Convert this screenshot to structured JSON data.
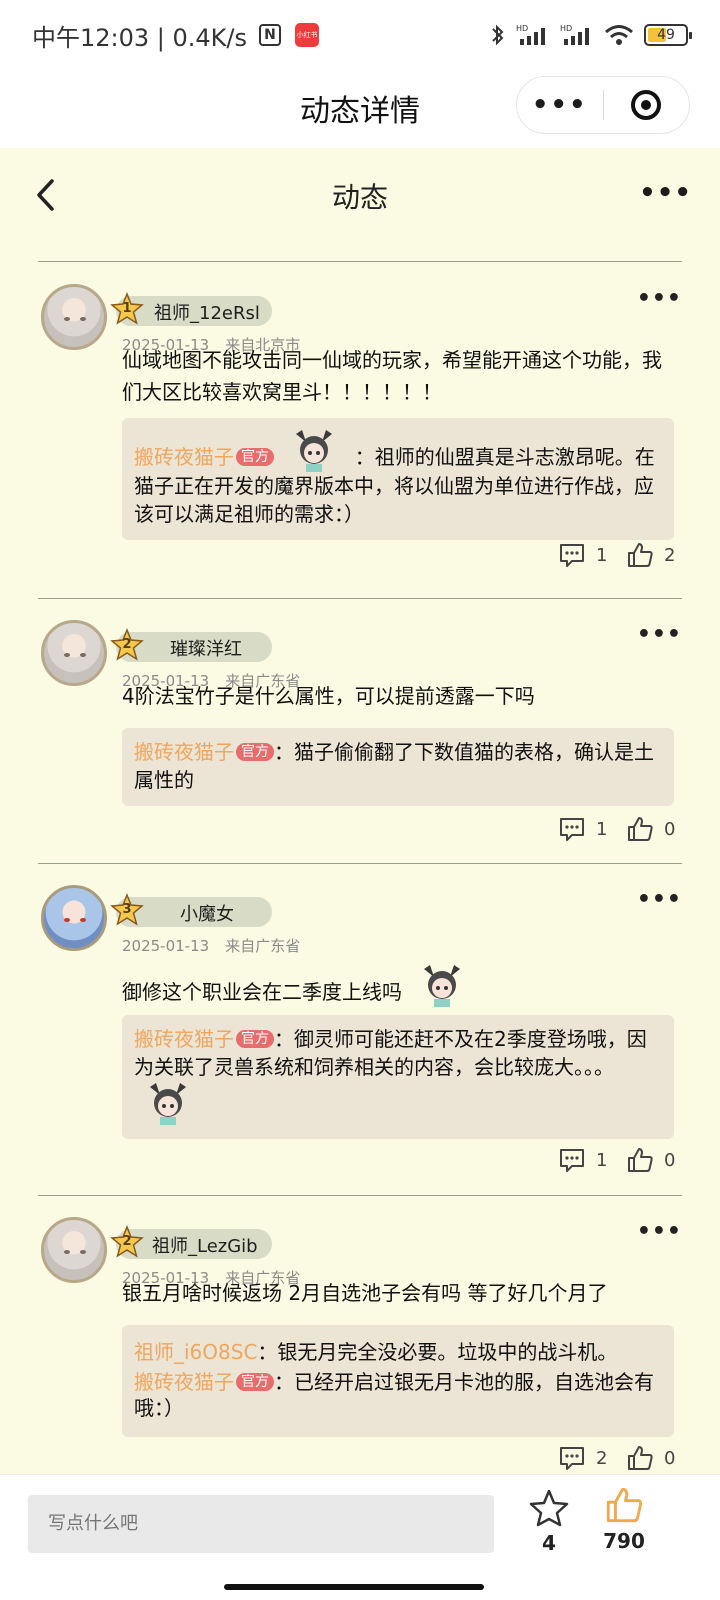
{
  "status_bar": {
    "time_speed": "中午12:03 | 0.4K/s",
    "app_badge": "小红书",
    "battery": "49"
  },
  "titlebar": {
    "title": "动态详情",
    "more_label": "•••"
  },
  "page": {
    "title": "动态",
    "more_label": "•••"
  },
  "posts": [
    {
      "rank": "1",
      "name": "祖师_12eRsl",
      "date": "2025-01-13",
      "location": "来自北京市",
      "content": "仙域地图不能攻击同一仙域的玩家，希望能开通这个功能，我们大区比较喜欢窝里斗！！！！！！",
      "replies": [
        {
          "author": "搬砖夜猫子",
          "badge": "官方",
          "text": "：祖师的仙盟真是斗志激昂呢。在猫子正在开发的魔界版本中，将以仙盟为单位进行作战，应该可以满足祖师的需求：）"
        }
      ],
      "comment_count": "1",
      "like_count": "2"
    },
    {
      "rank": "2",
      "name": "璀璨洋红",
      "date": "2025-01-13",
      "location": "来自广东省",
      "content": "4阶法宝竹子是什么属性，可以提前透露一下吗",
      "replies": [
        {
          "author": "搬砖夜猫子",
          "badge": "官方",
          "text": "：猫子偷偷翻了下数值猫的表格，确认是土属性的"
        }
      ],
      "comment_count": "1",
      "like_count": "0"
    },
    {
      "rank": "3",
      "name": "小魔女",
      "date": "2025-01-13",
      "location": "来自广东省",
      "content": "御修这个职业会在二季度上线吗",
      "replies": [
        {
          "author": "搬砖夜猫子",
          "badge": "官方",
          "text": "：御灵师可能还赶不及在2季度登场哦，因为关联了灵兽系统和饲养相关的内容，会比较庞大。。。"
        }
      ],
      "comment_count": "1",
      "like_count": "0"
    },
    {
      "rank": "2",
      "name": "祖师_LezGib",
      "date": "2025-01-13",
      "location": "来自广东省",
      "content": "银五月啥时候返场 2月自选池子会有吗 等了好几个月了",
      "replies": [
        {
          "author": "祖师_i6O8SC",
          "badge": "",
          "text": "：银无月完全没必要。垃圾中的战斗机。"
        },
        {
          "author": "搬砖夜猫子",
          "badge": "官方",
          "text": "：已经开启过银无月卡池的服，自选池会有哦：）"
        }
      ],
      "comment_count": "2",
      "like_count": "0"
    }
  ],
  "bottom": {
    "input_placeholder": "写点什么吧",
    "favorite_count": "4",
    "like_count": "790"
  },
  "colors": {
    "page_bg": "#fbfae2",
    "official_name": "#efa65e",
    "official_badge": "#e86c6c",
    "like_active": "#f2a94a"
  }
}
